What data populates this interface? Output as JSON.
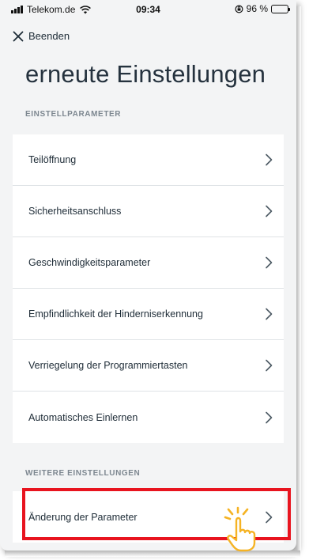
{
  "status_bar": {
    "carrier": "Telekom.de",
    "time": "09:34",
    "battery_text": "96 %",
    "battery_level": 0.96
  },
  "header": {
    "close_label": "Beenden",
    "title": "erneute Einstellungen"
  },
  "sections": {
    "params_header": "EINSTELLPARAMETER",
    "params_items": [
      "Teilöffnung",
      "Sicherheitsanschluss",
      "Geschwindigkeitsparameter",
      "Empfindlichkeit der Hinderniserkennung",
      "Verriegelung der Programmiertasten",
      "Automatisches Einlernen"
    ],
    "more_header": "WEITERE EINSTELLUNGEN",
    "more_items": [
      "Änderung der Parameter"
    ]
  },
  "colors": {
    "highlight": "#e8141f",
    "hand": "#f5b324"
  },
  "icons": {
    "close": "close-icon",
    "chevron": "chevron-right-icon",
    "pointer": "pointing-hand-icon"
  }
}
